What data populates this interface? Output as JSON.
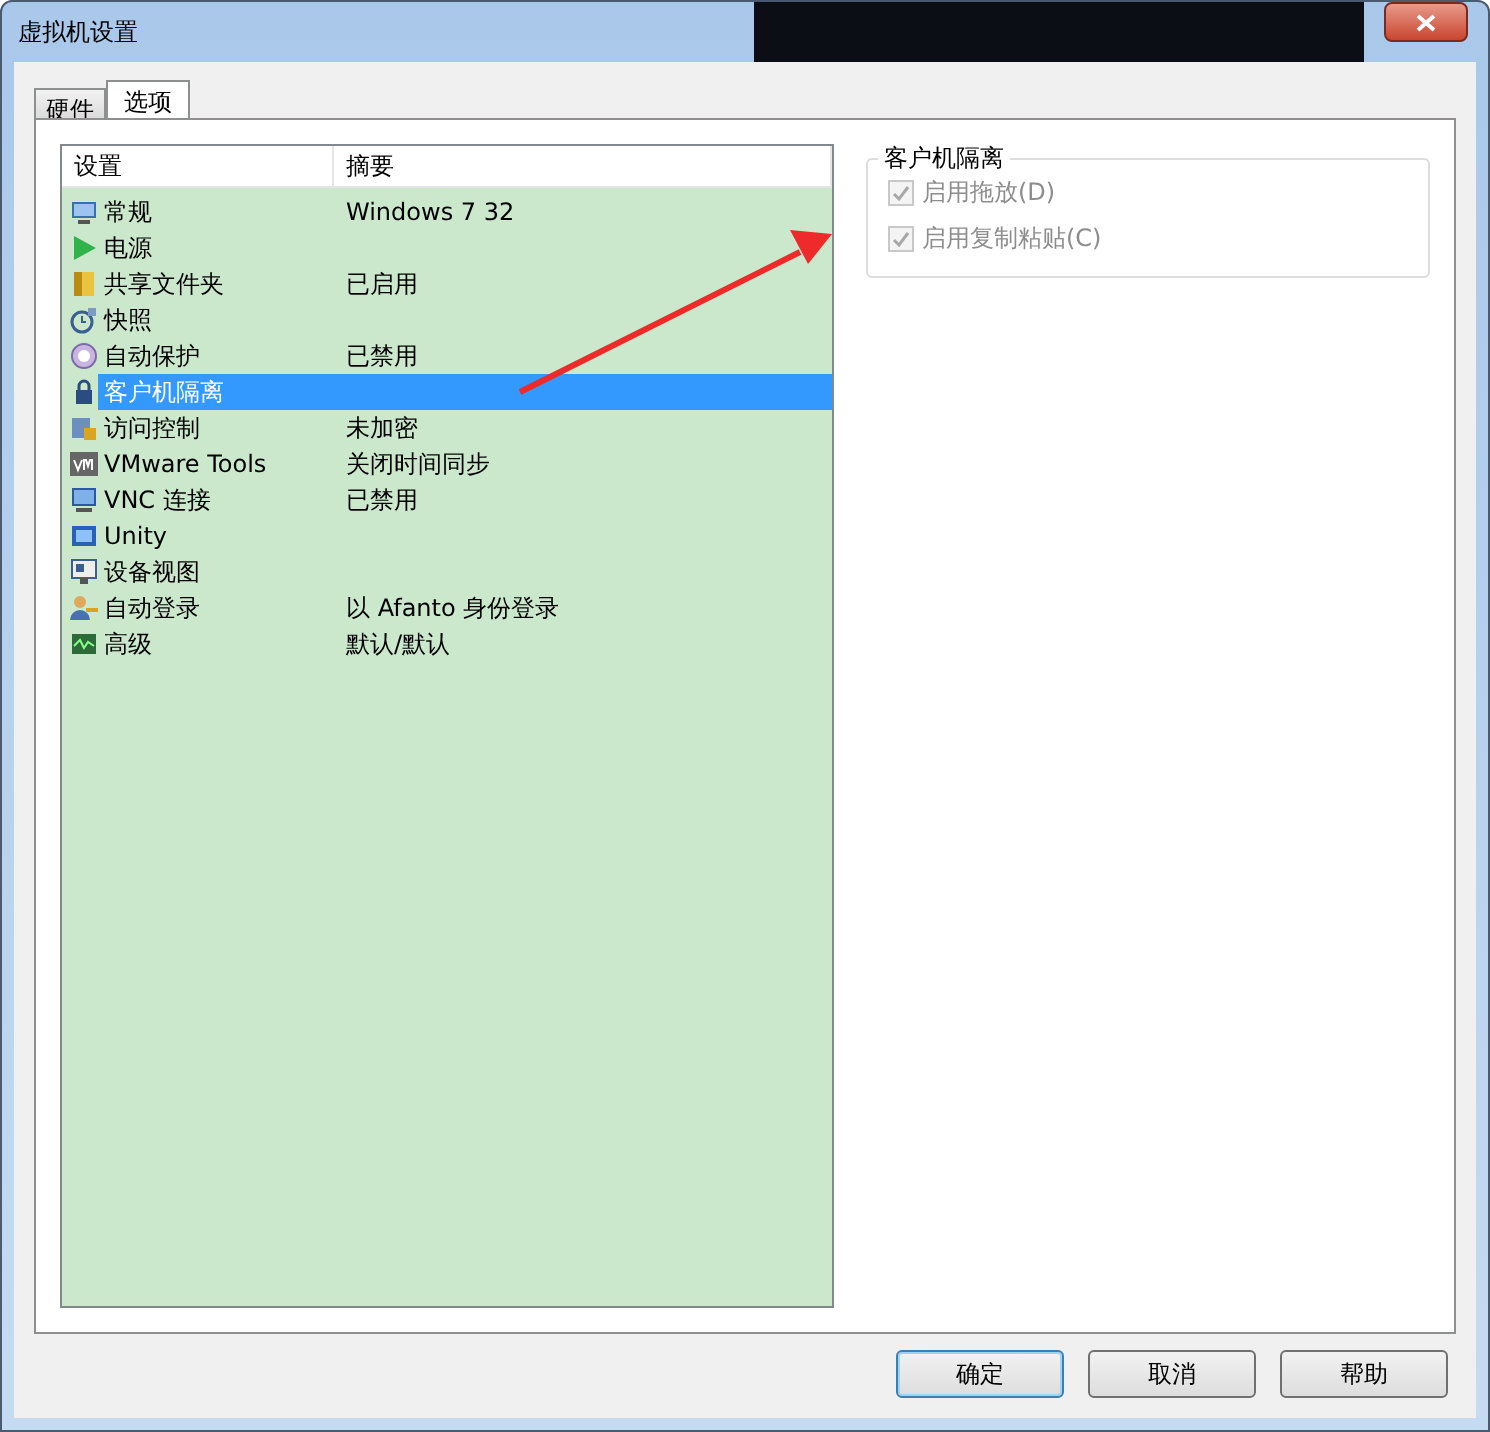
{
  "window": {
    "title": "虚拟机设置"
  },
  "tabs": [
    {
      "label": "硬件",
      "selected": false
    },
    {
      "label": "选项",
      "selected": true
    }
  ],
  "settings_list": {
    "columns": [
      "设置",
      "摘要"
    ],
    "rows": [
      {
        "name": "常规",
        "summary": "Windows 7 32",
        "selected": false
      },
      {
        "name": "电源",
        "summary": "",
        "selected": false
      },
      {
        "name": "共享文件夹",
        "summary": "已启用",
        "selected": false
      },
      {
        "name": "快照",
        "summary": "",
        "selected": false
      },
      {
        "name": "自动保护",
        "summary": "已禁用",
        "selected": false
      },
      {
        "name": "客户机隔离",
        "summary": "",
        "selected": true
      },
      {
        "name": "访问控制",
        "summary": "未加密",
        "selected": false
      },
      {
        "name": "VMware Tools",
        "summary": "关闭时间同步",
        "selected": false
      },
      {
        "name": "VNC 连接",
        "summary": "已禁用",
        "selected": false
      },
      {
        "name": "Unity",
        "summary": "",
        "selected": false
      },
      {
        "name": "设备视图",
        "summary": "",
        "selected": false
      },
      {
        "name": "自动登录",
        "summary": "以 Afanto 身份登录",
        "selected": false
      },
      {
        "name": "高级",
        "summary": "默认/默认",
        "selected": false
      }
    ]
  },
  "isolation_group": {
    "title": "客户机隔离",
    "options": [
      {
        "label": "启用拖放(D)",
        "checked": true,
        "disabled": true
      },
      {
        "label": "启用复制粘贴(C)",
        "checked": true,
        "disabled": true
      }
    ]
  },
  "buttons": [
    {
      "label": "确定",
      "default": true
    },
    {
      "label": "取消",
      "default": false
    },
    {
      "label": "帮助",
      "default": false
    }
  ]
}
